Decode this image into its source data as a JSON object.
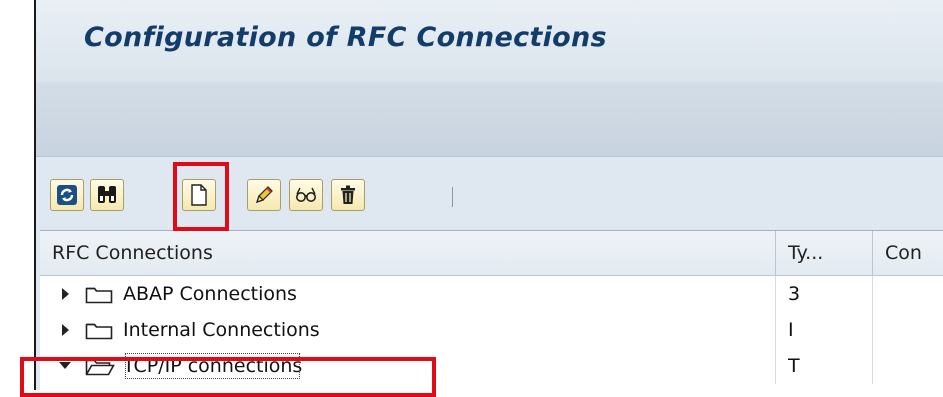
{
  "window": {
    "title": "Configuration of RFC Connections"
  },
  "toolbar": {
    "buttons": [
      {
        "name": "refresh-button",
        "icon": "refresh-icon"
      },
      {
        "name": "find-button",
        "icon": "binoculars-icon"
      },
      {
        "name": "create-button",
        "icon": "new-document-icon"
      },
      {
        "name": "change-button",
        "icon": "pencil-icon"
      },
      {
        "name": "display-button",
        "icon": "glasses-icon"
      },
      {
        "name": "delete-button",
        "icon": "trash-icon"
      }
    ],
    "highlight_color": "#e10b17"
  },
  "grid": {
    "columns": [
      "RFC Connections",
      "Ty...",
      "Con"
    ],
    "rows": [
      {
        "label": "ABAP Connections",
        "type": "3",
        "expanded": false
      },
      {
        "label": "Internal Connections",
        "type": "I",
        "expanded": false
      },
      {
        "label": "TCP/IP connections",
        "type": "T",
        "expanded": true,
        "selected": true
      }
    ]
  }
}
